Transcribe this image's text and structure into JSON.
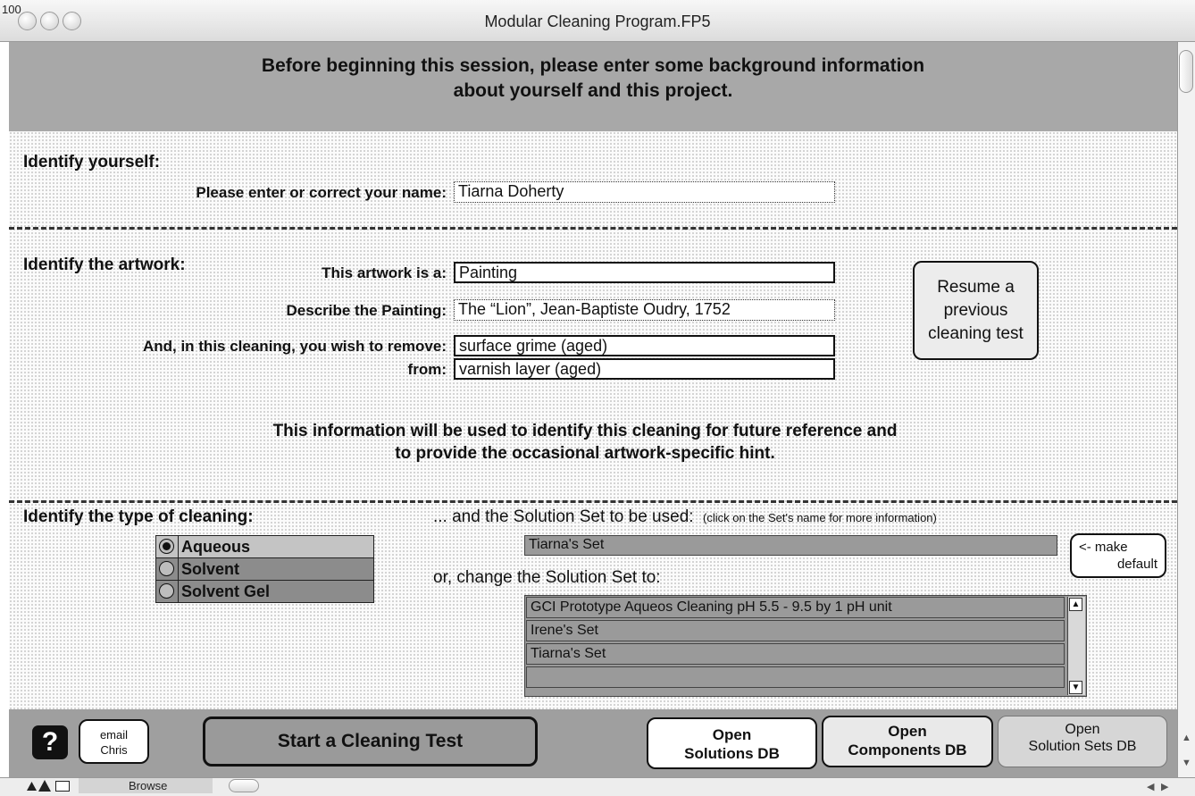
{
  "window": {
    "title": "Modular Cleaning Program.FP5"
  },
  "header": {
    "line1": "Before beginning this session, please enter some background information",
    "line2": "about yourself and this project."
  },
  "identify_yourself": {
    "heading": "Identify yourself:",
    "name_label": "Please enter or correct your name:",
    "name_value": "Tiarna Doherty"
  },
  "identify_artwork": {
    "heading": "Identify the artwork:",
    "type_label": "This artwork is a:",
    "type_value": "Painting",
    "describe_label": "Describe the Painting:",
    "describe_value": "The “Lion”, Jean-Baptiste Oudry, 1752",
    "remove_label": "And, in this cleaning, you wish to remove:",
    "remove_value": "surface grime (aged)",
    "from_label": "from:",
    "from_value": "varnish layer (aged)",
    "resume_button": {
      "line1": "Resume a",
      "line2": "previous",
      "line3": "cleaning test"
    }
  },
  "info": {
    "line1": "This information will be used to identify this cleaning for future reference and",
    "line2": "to provide the occasional artwork-specific hint."
  },
  "cleaning_type": {
    "heading": "Identify the type of cleaning:",
    "options": [
      {
        "label": "Aqueous",
        "selected": true
      },
      {
        "label": "Solvent",
        "selected": false
      },
      {
        "label": "Solvent Gel",
        "selected": false
      }
    ]
  },
  "solution_set": {
    "heading": "... and the Solution Set to be used:",
    "hint": "(click on the Set's name for more information)",
    "current": "Tiarna's Set",
    "make_default": {
      "line1": "<- make",
      "line2": "default"
    },
    "change_label": "or, change the Solution Set to:",
    "list": [
      "GCI Prototype Aqueos Cleaning pH 5.5 - 9.5 by 1 pH unit",
      "Irene's Set",
      "Tiarna's Set",
      ""
    ]
  },
  "bottom": {
    "help_icon": "?",
    "email": {
      "line1": "email",
      "line2": "Chris"
    },
    "start_button": "Start a Cleaning Test",
    "open_solutions": {
      "line1": "Open",
      "line2": "Solutions DB"
    },
    "open_components": {
      "line1": "Open",
      "line2": "Components DB"
    },
    "open_solution_sets": {
      "line1": "Open",
      "line2": "Solution Sets DB"
    }
  },
  "status": {
    "zoom": "100",
    "mode": "Browse"
  },
  "icons": {
    "traffic": "circle",
    "scroll_up": "up-arrow-icon",
    "scroll_down": "down-arrow-icon",
    "help": "question-icon"
  }
}
